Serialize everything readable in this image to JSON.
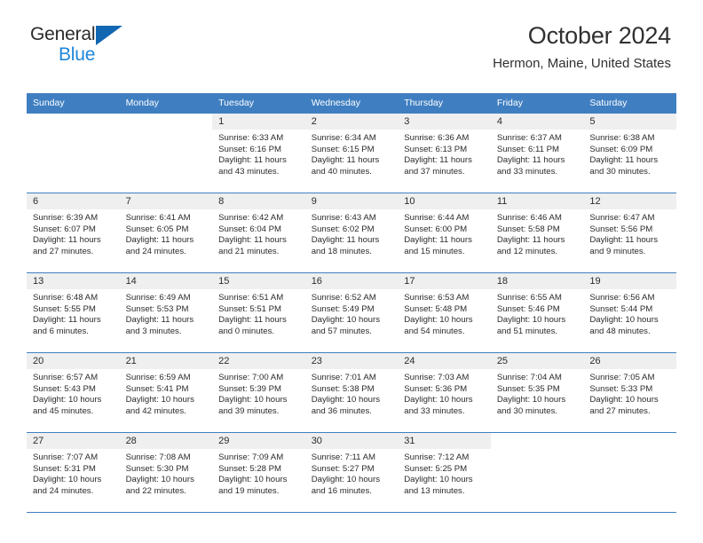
{
  "logo": {
    "line1": "General",
    "line2": "Blue",
    "triangle_color": "#1267b2",
    "line2_color": "#1f86d8"
  },
  "header": {
    "title": "October 2024",
    "subtitle": "Hermon, Maine, United States"
  },
  "theme": {
    "header_blue": "#3f7fc1",
    "daynum_band": "#efefef"
  },
  "weekdays": [
    "Sunday",
    "Monday",
    "Tuesday",
    "Wednesday",
    "Thursday",
    "Friday",
    "Saturday"
  ],
  "labels": {
    "sunrise_prefix": "Sunrise: ",
    "sunset_prefix": "Sunset: ",
    "daylight_prefix": "Daylight: "
  },
  "weeks": [
    [
      {
        "day": "",
        "blank": true
      },
      {
        "day": "",
        "blank": true
      },
      {
        "day": "1",
        "sunrise": "Sunrise: 6:33 AM",
        "sunset": "Sunset: 6:16 PM",
        "daylight1": "Daylight: 11 hours",
        "daylight2": "and 43 minutes."
      },
      {
        "day": "2",
        "sunrise": "Sunrise: 6:34 AM",
        "sunset": "Sunset: 6:15 PM",
        "daylight1": "Daylight: 11 hours",
        "daylight2": "and 40 minutes."
      },
      {
        "day": "3",
        "sunrise": "Sunrise: 6:36 AM",
        "sunset": "Sunset: 6:13 PM",
        "daylight1": "Daylight: 11 hours",
        "daylight2": "and 37 minutes."
      },
      {
        "day": "4",
        "sunrise": "Sunrise: 6:37 AM",
        "sunset": "Sunset: 6:11 PM",
        "daylight1": "Daylight: 11 hours",
        "daylight2": "and 33 minutes."
      },
      {
        "day": "5",
        "sunrise": "Sunrise: 6:38 AM",
        "sunset": "Sunset: 6:09 PM",
        "daylight1": "Daylight: 11 hours",
        "daylight2": "and 30 minutes."
      }
    ],
    [
      {
        "day": "6",
        "sunrise": "Sunrise: 6:39 AM",
        "sunset": "Sunset: 6:07 PM",
        "daylight1": "Daylight: 11 hours",
        "daylight2": "and 27 minutes."
      },
      {
        "day": "7",
        "sunrise": "Sunrise: 6:41 AM",
        "sunset": "Sunset: 6:05 PM",
        "daylight1": "Daylight: 11 hours",
        "daylight2": "and 24 minutes."
      },
      {
        "day": "8",
        "sunrise": "Sunrise: 6:42 AM",
        "sunset": "Sunset: 6:04 PM",
        "daylight1": "Daylight: 11 hours",
        "daylight2": "and 21 minutes."
      },
      {
        "day": "9",
        "sunrise": "Sunrise: 6:43 AM",
        "sunset": "Sunset: 6:02 PM",
        "daylight1": "Daylight: 11 hours",
        "daylight2": "and 18 minutes."
      },
      {
        "day": "10",
        "sunrise": "Sunrise: 6:44 AM",
        "sunset": "Sunset: 6:00 PM",
        "daylight1": "Daylight: 11 hours",
        "daylight2": "and 15 minutes."
      },
      {
        "day": "11",
        "sunrise": "Sunrise: 6:46 AM",
        "sunset": "Sunset: 5:58 PM",
        "daylight1": "Daylight: 11 hours",
        "daylight2": "and 12 minutes."
      },
      {
        "day": "12",
        "sunrise": "Sunrise: 6:47 AM",
        "sunset": "Sunset: 5:56 PM",
        "daylight1": "Daylight: 11 hours",
        "daylight2": "and 9 minutes."
      }
    ],
    [
      {
        "day": "13",
        "sunrise": "Sunrise: 6:48 AM",
        "sunset": "Sunset: 5:55 PM",
        "daylight1": "Daylight: 11 hours",
        "daylight2": "and 6 minutes."
      },
      {
        "day": "14",
        "sunrise": "Sunrise: 6:49 AM",
        "sunset": "Sunset: 5:53 PM",
        "daylight1": "Daylight: 11 hours",
        "daylight2": "and 3 minutes."
      },
      {
        "day": "15",
        "sunrise": "Sunrise: 6:51 AM",
        "sunset": "Sunset: 5:51 PM",
        "daylight1": "Daylight: 11 hours",
        "daylight2": "and 0 minutes."
      },
      {
        "day": "16",
        "sunrise": "Sunrise: 6:52 AM",
        "sunset": "Sunset: 5:49 PM",
        "daylight1": "Daylight: 10 hours",
        "daylight2": "and 57 minutes."
      },
      {
        "day": "17",
        "sunrise": "Sunrise: 6:53 AM",
        "sunset": "Sunset: 5:48 PM",
        "daylight1": "Daylight: 10 hours",
        "daylight2": "and 54 minutes."
      },
      {
        "day": "18",
        "sunrise": "Sunrise: 6:55 AM",
        "sunset": "Sunset: 5:46 PM",
        "daylight1": "Daylight: 10 hours",
        "daylight2": "and 51 minutes."
      },
      {
        "day": "19",
        "sunrise": "Sunrise: 6:56 AM",
        "sunset": "Sunset: 5:44 PM",
        "daylight1": "Daylight: 10 hours",
        "daylight2": "and 48 minutes."
      }
    ],
    [
      {
        "day": "20",
        "sunrise": "Sunrise: 6:57 AM",
        "sunset": "Sunset: 5:43 PM",
        "daylight1": "Daylight: 10 hours",
        "daylight2": "and 45 minutes."
      },
      {
        "day": "21",
        "sunrise": "Sunrise: 6:59 AM",
        "sunset": "Sunset: 5:41 PM",
        "daylight1": "Daylight: 10 hours",
        "daylight2": "and 42 minutes."
      },
      {
        "day": "22",
        "sunrise": "Sunrise: 7:00 AM",
        "sunset": "Sunset: 5:39 PM",
        "daylight1": "Daylight: 10 hours",
        "daylight2": "and 39 minutes."
      },
      {
        "day": "23",
        "sunrise": "Sunrise: 7:01 AM",
        "sunset": "Sunset: 5:38 PM",
        "daylight1": "Daylight: 10 hours",
        "daylight2": "and 36 minutes."
      },
      {
        "day": "24",
        "sunrise": "Sunrise: 7:03 AM",
        "sunset": "Sunset: 5:36 PM",
        "daylight1": "Daylight: 10 hours",
        "daylight2": "and 33 minutes."
      },
      {
        "day": "25",
        "sunrise": "Sunrise: 7:04 AM",
        "sunset": "Sunset: 5:35 PM",
        "daylight1": "Daylight: 10 hours",
        "daylight2": "and 30 minutes."
      },
      {
        "day": "26",
        "sunrise": "Sunrise: 7:05 AM",
        "sunset": "Sunset: 5:33 PM",
        "daylight1": "Daylight: 10 hours",
        "daylight2": "and 27 minutes."
      }
    ],
    [
      {
        "day": "27",
        "sunrise": "Sunrise: 7:07 AM",
        "sunset": "Sunset: 5:31 PM",
        "daylight1": "Daylight: 10 hours",
        "daylight2": "and 24 minutes."
      },
      {
        "day": "28",
        "sunrise": "Sunrise: 7:08 AM",
        "sunset": "Sunset: 5:30 PM",
        "daylight1": "Daylight: 10 hours",
        "daylight2": "and 22 minutes."
      },
      {
        "day": "29",
        "sunrise": "Sunrise: 7:09 AM",
        "sunset": "Sunset: 5:28 PM",
        "daylight1": "Daylight: 10 hours",
        "daylight2": "and 19 minutes."
      },
      {
        "day": "30",
        "sunrise": "Sunrise: 7:11 AM",
        "sunset": "Sunset: 5:27 PM",
        "daylight1": "Daylight: 10 hours",
        "daylight2": "and 16 minutes."
      },
      {
        "day": "31",
        "sunrise": "Sunrise: 7:12 AM",
        "sunset": "Sunset: 5:25 PM",
        "daylight1": "Daylight: 10 hours",
        "daylight2": "and 13 minutes."
      },
      {
        "day": "",
        "blank": true
      },
      {
        "day": "",
        "blank": true
      }
    ]
  ]
}
